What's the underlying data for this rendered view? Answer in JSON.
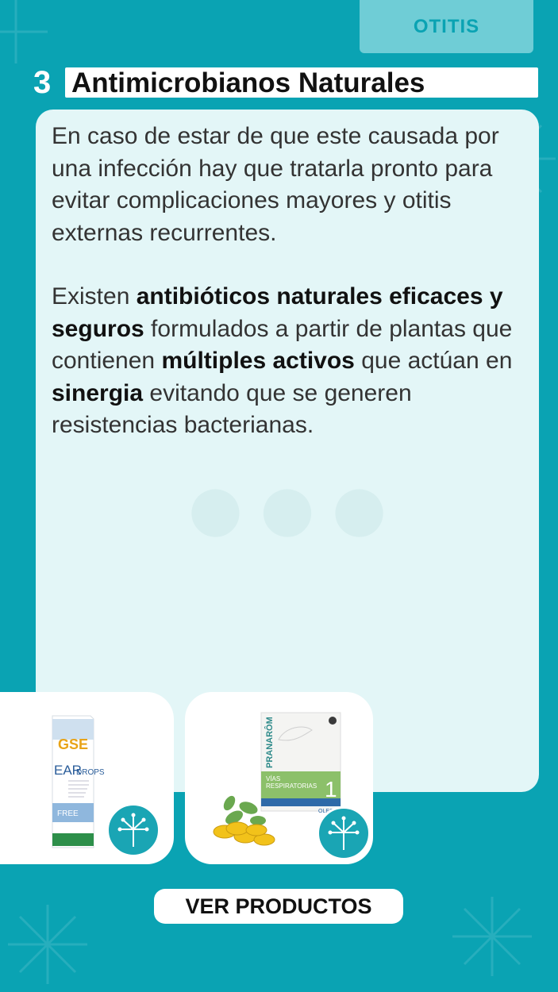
{
  "header": {
    "category_tag": "OTITIS"
  },
  "section": {
    "number": "3",
    "title": "Antimicrobianos Naturales"
  },
  "content": {
    "paragraph1": "En caso de estar de que este causada por una infección hay que tratarla pronto para evitar complicaciones mayores y otitis externas recurrentes.",
    "paragraph2": {
      "t1": "Existen ",
      "b1": "antibióticos naturales eficaces y seguros",
      "t2": " formulados a partir de plantas que contienen ",
      "b2": "múltiples activos",
      "t3": " que actúan en ",
      "b3": "sinergia",
      "t4": " evitando que se generen resistencias bacterianas."
    }
  },
  "products": [
    {
      "brand": "GSE",
      "name_part1": "EAR",
      "name_part2": "DROPS",
      "variant": "FREE",
      "icon": "dandelion-icon"
    },
    {
      "brand": "PRANARÔM",
      "line1": "VÍAS",
      "line2": "RESPIRATORIAS",
      "number": "1",
      "label": "OLEOCAPS",
      "icon": "dandelion-icon"
    }
  ],
  "cta": {
    "label": "VER PRODUCTOS"
  },
  "colors": {
    "background": "#0aa3b3",
    "card": "#e3f6f7",
    "tag": "#6fcdd6",
    "accent": "#1aa5b4"
  }
}
